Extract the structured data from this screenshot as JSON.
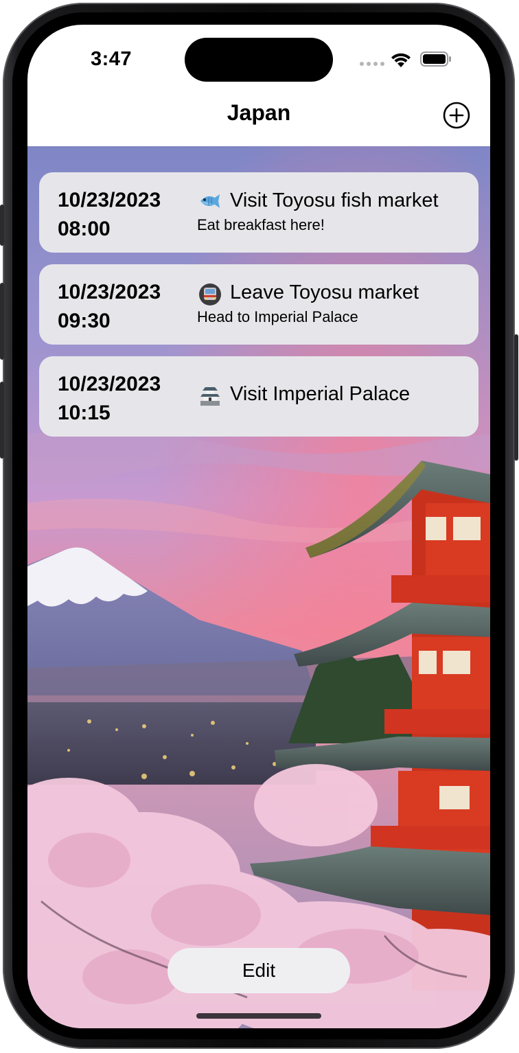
{
  "status_bar": {
    "time": "3:47"
  },
  "nav": {
    "title": "Japan",
    "add_icon": "plus-circle-icon"
  },
  "itinerary": [
    {
      "date": "10/23/2023",
      "time": "08:00",
      "emoji": "fish-emoji",
      "title": "Visit Toyosu fish market",
      "subtitle": "Eat breakfast here!"
    },
    {
      "date": "10/23/2023",
      "time": "09:30",
      "emoji": "train-emoji",
      "title": "Leave Toyosu market",
      "subtitle": "Head to Imperial Palace"
    },
    {
      "date": "10/23/2023",
      "time": "10:15",
      "emoji": "castle-emoji",
      "title": "Visit Imperial Palace",
      "subtitle": ""
    }
  ],
  "edit_button": {
    "label": "Edit"
  },
  "colors": {
    "card_background": "#e6e6ea",
    "sky_top": "#7f86c6",
    "sky_bottom": "#e8839a",
    "pagoda_red": "#d8321c"
  }
}
